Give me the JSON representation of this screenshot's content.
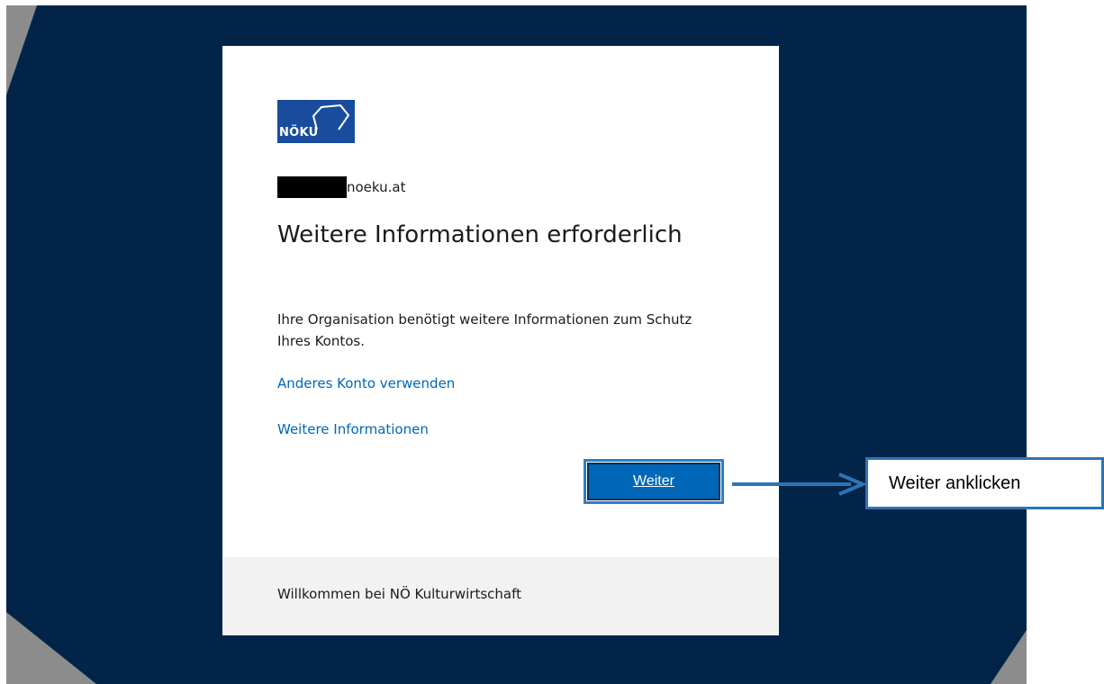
{
  "brand": {
    "logo_text": "NÖKU",
    "accent": "#0067b8",
    "background": "#022448"
  },
  "account": {
    "domain": "noeku.at"
  },
  "dialog": {
    "title": "Weitere Informationen erforderlich",
    "description": "Ihre Organisation benötigt weitere Informationen zum Schutz Ihres Kontos.",
    "link_other_account": "Anderes Konto verwenden",
    "link_more_info": "Weitere Informationen",
    "next_button": "Weiter"
  },
  "footer": {
    "text": "Willkommen bei NÖ Kulturwirtschaft"
  },
  "annotation": {
    "callout_text": "Weiter anklicken"
  }
}
